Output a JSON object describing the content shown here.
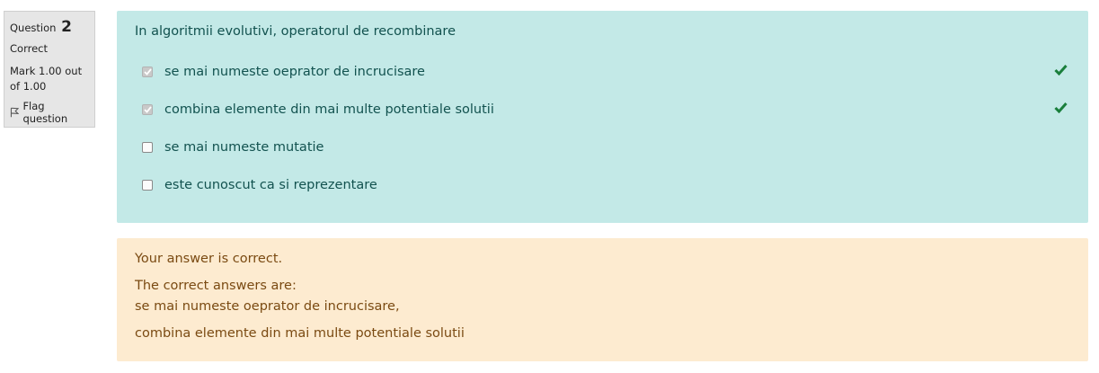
{
  "info": {
    "question_label": "Question",
    "question_number": "2",
    "state": "Correct",
    "grade": "Mark 1.00 out of 1.00",
    "flag_label": "Flag question"
  },
  "question": {
    "text": "In algoritmii evolutivi, operatorul de recombinare",
    "answers": [
      {
        "label": "se mai numeste oeprator de incrucisare",
        "checked": true,
        "correct": true
      },
      {
        "label": "combina elemente din mai multe potentiale solutii",
        "checked": true,
        "correct": true
      },
      {
        "label": "se mai numeste mutatie",
        "checked": false,
        "correct": false
      },
      {
        "label": "este cunoscut ca si reprezentare",
        "checked": false,
        "correct": false
      }
    ]
  },
  "feedback": {
    "summary": "Your answer is correct.",
    "correct_intro": "The correct answers are:",
    "correct_answers": [
      "se mai numeste oeprator de incrucisare,",
      "combina elemente din mai multe potentiale solutii"
    ]
  },
  "colors": {
    "question_bg": "#c3e9e7",
    "question_text": "#12524f",
    "feedback_bg": "#fdebd0",
    "feedback_text": "#7a4a12",
    "tick": "#1a7f3c"
  },
  "icons": {
    "tick": "check-icon",
    "flag": "flag-icon"
  }
}
